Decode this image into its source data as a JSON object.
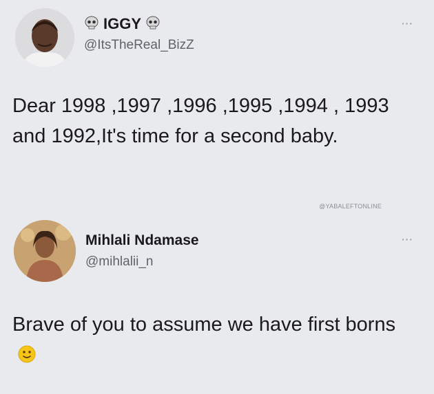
{
  "tweets": [
    {
      "display_name": "IGGY",
      "handle": "@ItsTheReal_BizZ",
      "name_icons": [
        "skull-icon",
        "skull-icon"
      ],
      "text": "Dear 1998 ,1997 ,1996 ,1995 ,1994 , 1993 and 1992,It's time for a second baby."
    },
    {
      "display_name": "Mihlali Ndamase",
      "handle": "@mihlalii_n",
      "text": "Brave of you to assume we have first borns",
      "trailing_icon": "slightly-smiling-face-icon"
    }
  ],
  "watermark": "@YABALEFTONLINE",
  "more_label": "···",
  "colors": {
    "background": "#e9eaee",
    "text": "#1a1a1a",
    "handle": "#5f6368"
  }
}
